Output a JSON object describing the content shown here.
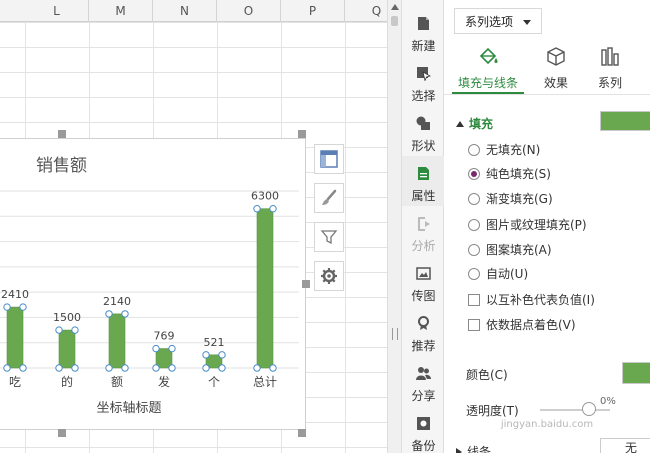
{
  "sheet": {
    "columns": [
      "L",
      "M",
      "N",
      "O",
      "P",
      "Q"
    ]
  },
  "chart_data": {
    "type": "bar",
    "title": "销售额",
    "xlabel": "坐标轴标题",
    "ylabel": "",
    "categories": [
      "吃",
      "的",
      "额",
      "发",
      "个",
      "总计"
    ],
    "values": [
      2410,
      1500,
      2140,
      769,
      521,
      6300
    ],
    "data_labels": [
      "2410",
      "1500",
      "2140",
      "769",
      "521",
      "6300"
    ],
    "ylim": [
      0,
      7000
    ],
    "grid": true,
    "bar_color": "#69a84f",
    "selected_series": true
  },
  "chart_tools": [
    {
      "icon": "chart-elements-icon"
    },
    {
      "icon": "brush-icon"
    },
    {
      "icon": "filter-icon"
    },
    {
      "icon": "gear-icon"
    }
  ],
  "toolstrip": {
    "items": [
      {
        "label": "新建",
        "icon": "new-icon"
      },
      {
        "label": "选择",
        "icon": "select-icon"
      },
      {
        "label": "形状",
        "icon": "shape-icon"
      },
      {
        "label": "属性",
        "icon": "properties-icon",
        "active": true
      },
      {
        "label": "分析",
        "icon": "analysis-icon",
        "disabled": true
      },
      {
        "label": "传图",
        "icon": "upload-image-icon"
      },
      {
        "label": "推荐",
        "icon": "recommend-icon"
      },
      {
        "label": "分享",
        "icon": "share-icon"
      },
      {
        "label": "备份",
        "icon": "backup-icon"
      }
    ]
  },
  "panel": {
    "series_dropdown": "系列选项",
    "tabs": [
      {
        "label": "填充与线条",
        "icon": "fill-bucket-icon",
        "active": true
      },
      {
        "label": "效果",
        "icon": "cube-icon"
      },
      {
        "label": "系列",
        "icon": "series-bars-icon"
      }
    ],
    "fill_section": "填充",
    "fill_options": [
      {
        "label": "无填充(N)",
        "selected": false
      },
      {
        "label": "纯色填充(S)",
        "selected": true
      },
      {
        "label": "渐变填充(G)",
        "selected": false
      },
      {
        "label": "图片或纹理填充(P)",
        "selected": false
      },
      {
        "label": "图案填充(A)",
        "selected": false
      },
      {
        "label": "自动(U)",
        "selected": false
      }
    ],
    "checkboxes": [
      {
        "label": "以互补色代表负值(I)",
        "checked": false
      },
      {
        "label": "依数据点着色(V)",
        "checked": false
      }
    ],
    "color_label": "颜色(C)",
    "color_value": "#69a84f",
    "transparency_label": "透明度(T)",
    "transparency_value": "0%",
    "line_section": "线条",
    "line_value": "无"
  },
  "watermark": "jingyan.baidu.com"
}
